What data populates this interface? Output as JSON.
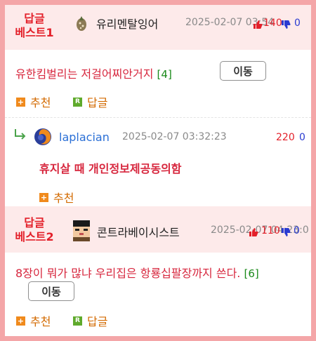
{
  "best1": {
    "label_line1": "답글",
    "label_line2": "베스트1",
    "nickname": "유리멘탈잉어",
    "date": "2025-02-07 03:54",
    "up": "140",
    "down": "0",
    "title": "유한킴벌리는 저걸어찌안거지",
    "reply_count": "[4]",
    "move_label": "이동",
    "recommend_label": "추천",
    "reply_label": "답글"
  },
  "reply": {
    "nickname": "laplacian",
    "date": "2025-02-07 03:32:23",
    "up": "220",
    "down": "0",
    "text": "휴지살 때 개인정보제공동의함",
    "recommend_label": "추천"
  },
  "best2": {
    "label_line1": "답글",
    "label_line2": "베스트2",
    "nickname": "콘트라베이시스트",
    "date": "2025-02-07 04:23:0",
    "up": "110",
    "down": "0",
    "title": "8장이 뭐가 많냐 우리집은 항룡십팔장까지 쓴다.",
    "reply_count": "[6]",
    "move_label": "이동",
    "recommend_label": "추천",
    "reply_label": "답글"
  },
  "colors": {
    "frame_border": "#f4a6a8",
    "best_bg": "#fdeaea",
    "accent_red": "#e3202a",
    "vote_down": "#2a3bd1",
    "action_orange": "#d36a00"
  },
  "icons": {
    "plus": "+",
    "reply_badge": "R"
  }
}
